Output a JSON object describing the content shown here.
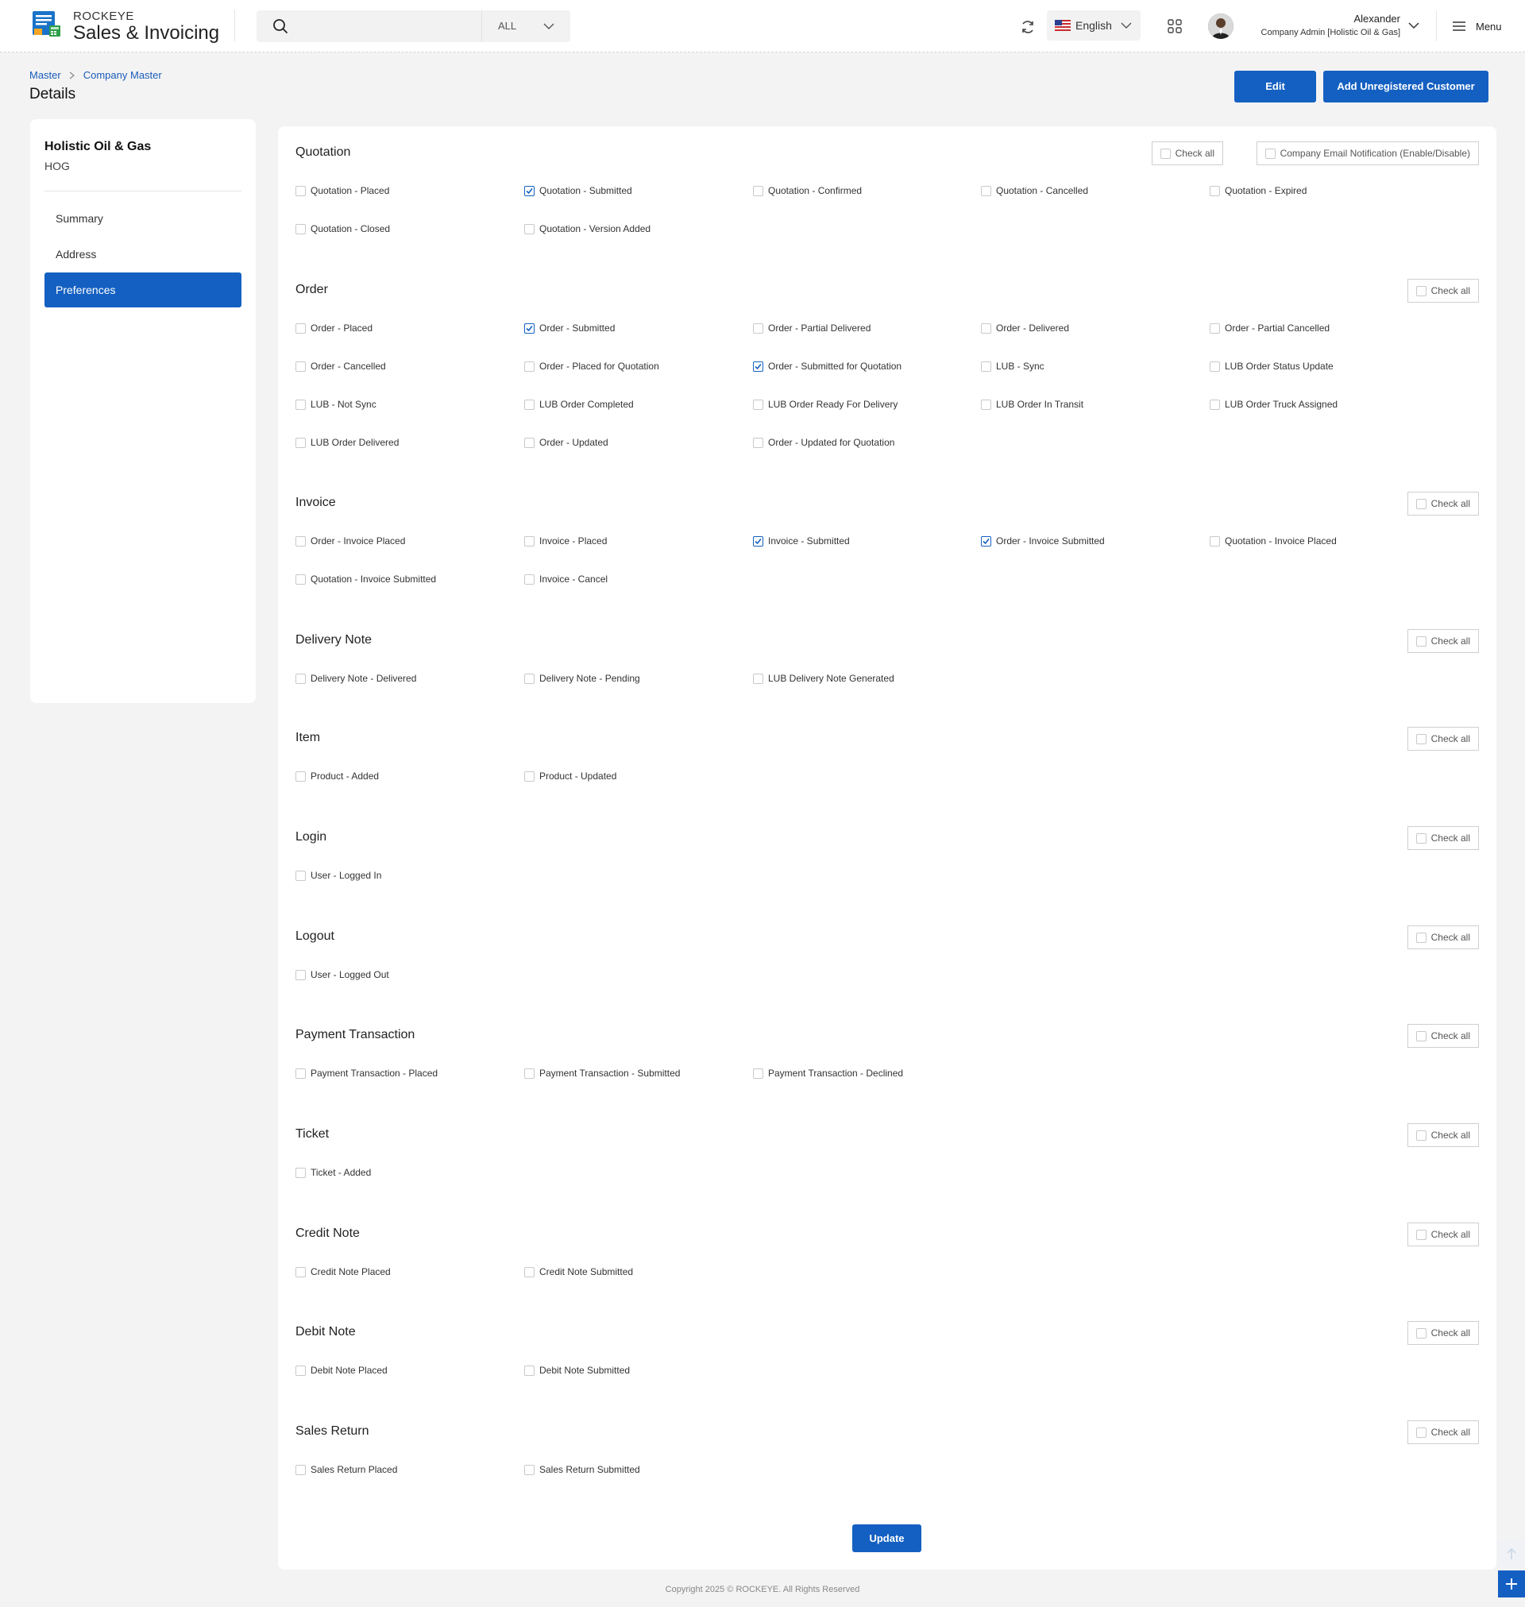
{
  "brand": {
    "small": "ROCKEYE",
    "big": "Sales & Invoicing"
  },
  "search": {
    "placeholder": "",
    "scope": "ALL"
  },
  "language": "English",
  "user": {
    "name": "Alexander",
    "role": "Company Admin [Holistic Oil & Gas]"
  },
  "menu_label": "Menu",
  "breadcrumb": [
    "Master",
    "Company Master"
  ],
  "page_title": "Details",
  "buttons": {
    "edit": "Edit",
    "add": "Add Unregistered Customer",
    "update": "Update"
  },
  "company": {
    "name": "Holistic Oil & Gas",
    "code": "HOG"
  },
  "nav": [
    {
      "label": "Summary",
      "active": false
    },
    {
      "label": "Address",
      "active": false
    },
    {
      "label": "Preferences",
      "active": true
    }
  ],
  "check_all_label": "Check all",
  "company_email_label": "Company Email Notification (Enable/Disable)",
  "sections": [
    {
      "title": "Quotation",
      "options": [
        {
          "label": "Quotation - Placed",
          "checked": false
        },
        {
          "label": "Quotation - Submitted",
          "checked": true
        },
        {
          "label": "Quotation - Confirmed",
          "checked": false
        },
        {
          "label": "Quotation - Cancelled",
          "checked": false
        },
        {
          "label": "Quotation - Expired",
          "checked": false
        },
        {
          "label": "Quotation - Closed",
          "checked": false
        },
        {
          "label": "Quotation - Version Added",
          "checked": false
        }
      ]
    },
    {
      "title": "Order",
      "options": [
        {
          "label": "Order - Placed",
          "checked": false
        },
        {
          "label": "Order - Submitted",
          "checked": true
        },
        {
          "label": "Order - Partial Delivered",
          "checked": false
        },
        {
          "label": "Order - Delivered",
          "checked": false
        },
        {
          "label": "Order - Partial Cancelled",
          "checked": false
        },
        {
          "label": "Order - Cancelled",
          "checked": false
        },
        {
          "label": "Order - Placed for Quotation",
          "checked": false
        },
        {
          "label": "Order - Submitted for Quotation",
          "checked": true
        },
        {
          "label": "LUB - Sync",
          "checked": false
        },
        {
          "label": "LUB Order Status Update",
          "checked": false
        },
        {
          "label": "LUB - Not Sync",
          "checked": false
        },
        {
          "label": "LUB Order Completed",
          "checked": false
        },
        {
          "label": "LUB Order Ready For Delivery",
          "checked": false
        },
        {
          "label": "LUB Order In Transit",
          "checked": false
        },
        {
          "label": "LUB Order Truck Assigned",
          "checked": false
        },
        {
          "label": "LUB Order Delivered",
          "checked": false
        },
        {
          "label": "Order - Updated",
          "checked": false
        },
        {
          "label": "Order - Updated for Quotation",
          "checked": false
        }
      ]
    },
    {
      "title": "Invoice",
      "options": [
        {
          "label": "Order - Invoice Placed",
          "checked": false
        },
        {
          "label": "Invoice - Placed",
          "checked": false
        },
        {
          "label": "Invoice - Submitted",
          "checked": true
        },
        {
          "label": "Order - Invoice Submitted",
          "checked": true
        },
        {
          "label": "Quotation - Invoice Placed",
          "checked": false
        },
        {
          "label": "Quotation - Invoice Submitted",
          "checked": false
        },
        {
          "label": "Invoice - Cancel",
          "checked": false
        }
      ]
    },
    {
      "title": "Delivery Note",
      "options": [
        {
          "label": "Delivery Note - Delivered",
          "checked": false
        },
        {
          "label": "Delivery Note - Pending",
          "checked": false
        },
        {
          "label": "LUB Delivery Note Generated",
          "checked": false
        }
      ]
    },
    {
      "title": "Item",
      "options": [
        {
          "label": "Product - Added",
          "checked": false
        },
        {
          "label": "Product - Updated",
          "checked": false
        }
      ]
    },
    {
      "title": "Login",
      "options": [
        {
          "label": "User - Logged In",
          "checked": false
        }
      ]
    },
    {
      "title": "Logout",
      "options": [
        {
          "label": "User - Logged Out",
          "checked": false
        }
      ]
    },
    {
      "title": "Payment Transaction",
      "options": [
        {
          "label": "Payment Transaction - Placed",
          "checked": false
        },
        {
          "label": "Payment Transaction - Submitted",
          "checked": false
        },
        {
          "label": "Payment Transaction - Declined",
          "checked": false
        }
      ]
    },
    {
      "title": "Ticket",
      "options": [
        {
          "label": "Ticket - Added",
          "checked": false
        }
      ]
    },
    {
      "title": "Credit Note",
      "options": [
        {
          "label": "Credit Note Placed",
          "checked": false
        },
        {
          "label": "Credit Note Submitted",
          "checked": false
        }
      ]
    },
    {
      "title": "Debit Note",
      "options": [
        {
          "label": "Debit Note Placed",
          "checked": false
        },
        {
          "label": "Debit Note Submitted",
          "checked": false
        }
      ]
    },
    {
      "title": "Sales Return",
      "options": [
        {
          "label": "Sales Return Placed",
          "checked": false
        },
        {
          "label": "Sales Return Submitted",
          "checked": false
        }
      ]
    }
  ],
  "footer": "Copyright 2025 © ROCKEYE. All Rights Reserved",
  "colors": {
    "primary": "#1460c2",
    "background": "#f3f3f4"
  }
}
